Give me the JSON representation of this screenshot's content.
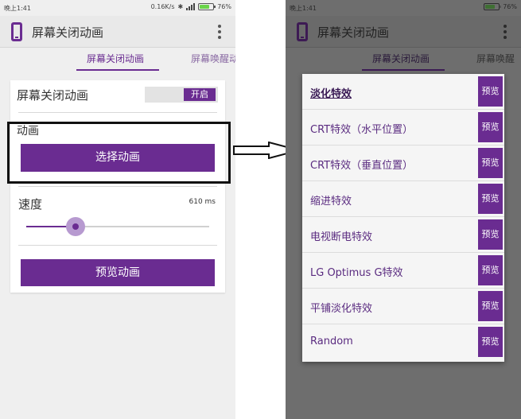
{
  "left": {
    "status": {
      "time": "晚上1:41",
      "speed": "0.16K/s",
      "battery": "76%",
      "battery_level": 0.76
    },
    "app_title": "屏幕关闭动画",
    "tabs": [
      {
        "label": "屏幕关闭动画"
      },
      {
        "label": "屏幕唤醒动"
      }
    ],
    "card": {
      "animation_label": "屏幕关闭动画",
      "toggle_label": "开启",
      "section_label": "动画",
      "select_button": "选择动画",
      "speed_label": "速度",
      "speed_value": "610 ms",
      "speed_slider_fraction": 0.27,
      "preview_button": "预览动画"
    }
  },
  "right": {
    "status": {
      "time": "晚上1:41",
      "battery": "76%",
      "battery_level": 0.76
    },
    "app_title": "屏幕关闭动画",
    "tabs": [
      {
        "label": "屏幕关闭动画"
      },
      {
        "label": "屏幕唤醒"
      }
    ],
    "dialog": {
      "preview_label": "预览",
      "options": [
        {
          "label": "淡化特效",
          "selected": true
        },
        {
          "label": "CRT特效（水平位置）"
        },
        {
          "label": "CRT特效（垂直位置）"
        },
        {
          "label": "缩进特效"
        },
        {
          "label": "电视断电特效"
        },
        {
          "label": "LG Optimus G特效"
        },
        {
          "label": "平铺淡化特效"
        },
        {
          "label": "Random"
        }
      ]
    }
  },
  "colors": {
    "accent": "#6a2c91",
    "dim_overlay": "#6e6e6e"
  }
}
